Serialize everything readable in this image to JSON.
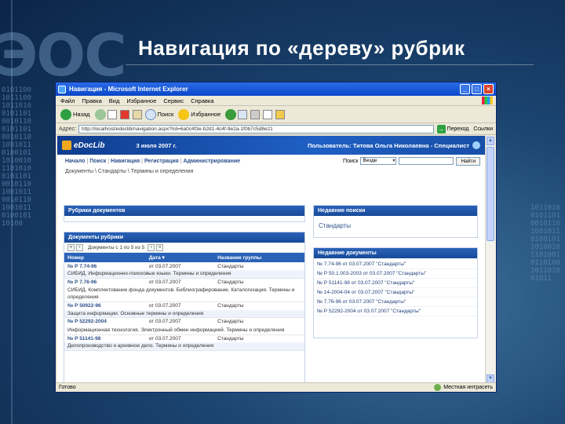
{
  "slide": {
    "title": "Навигация по «дереву» рубрик",
    "deco_logo": "ЭОС",
    "binary_left": "0101100101110010110100101101001011001011010010110100101101001011010010110101001011010010110100101100101101001011010010110100",
    "binary_right": "10110100101101001011010010110100101101001011010010110100101101001011"
  },
  "window": {
    "title": "Навигация - Microsoft Internet Explorer",
    "buttons": {
      "minimize": "_",
      "maximize": "□",
      "close": "×"
    },
    "menu": [
      "Файл",
      "Правка",
      "Вид",
      "Избранное",
      "Сервис",
      "Справка"
    ],
    "toolbar": {
      "back": "Назад",
      "search": "Поиск",
      "favorites": "Избранное"
    },
    "address": {
      "label": "Адрес:",
      "url": "http://localhost/edoclib/navigation.aspx?rid=6a0c4f3e-b2d1-4c4f-9e2a-1f0b7c5d8e21",
      "go": "Переход",
      "links": "Ссылки"
    },
    "status": {
      "text": "Готово",
      "zone": "Местная интрасеть"
    },
    "scroll": {
      "up": "▲",
      "down": "▼"
    }
  },
  "page": {
    "banner": {
      "logo": "eDocLib",
      "date": "3 июля 2007 г.",
      "user": "Пользователь: Титова Ольга Николаевна - Специалист"
    },
    "nav": [
      "Начало",
      "Поиск",
      "Навигация",
      "Регистрация",
      "Администрирование"
    ],
    "nav_sep": "|",
    "search": {
      "label": "Поиск",
      "scope": "Везде",
      "button": "Найти"
    },
    "breadcrumb": "Документы \\ Стандарты \\ Термины и определения",
    "panels": {
      "rubrics": "Рубрики документов",
      "recent_searches": "Недавние поиски",
      "documents": "Документы рубрики",
      "recent_documents": "Недавние документы"
    },
    "recent_search_items": [
      "Стандарты"
    ],
    "pager": {
      "first": "«",
      "prev": "‹",
      "text": "Документы с 1 по 5 из 5",
      "next": "›",
      "last": "»"
    },
    "table": {
      "headers": [
        "Номер",
        "Дата ▾",
        "Название группы"
      ],
      "rows": [
        {
          "number": "№ Р 7.74-96",
          "date": "от 03.07.2007",
          "group": "Стандарты",
          "title": "СИБИД. Информационно-поисковые языки. Термины и определения"
        },
        {
          "number": "№ Р 7.76-96",
          "date": "от 03.07.2007",
          "group": "Стандарты",
          "title": "СИБИД. Комплектование фонда документов. Библиографирование. Каталогизация. Термины и определения"
        },
        {
          "number": "№ Р 50922-96",
          "date": "от 03.07.2007",
          "group": "Стандарты",
          "title": "Защита информации. Основные термины и определения"
        },
        {
          "number": "№ Р 52292-2004",
          "date": "от 03.07.2007",
          "group": "Стандарты",
          "title": "Информационная технология. Электронный обмен информацией. Термины и определения"
        },
        {
          "number": "№ Р 51141-98",
          "date": "от 03.07.2007",
          "group": "Стандарты",
          "title": "Делопроизводство и архивное дело. Термины и определения"
        }
      ]
    },
    "recent_documents": [
      "№ 7.74-96 от 03.07.2007 \"Стандарты\"",
      "№ Р 50.1.003-2003 от 03.07.2007 \"Стандарты\"",
      "№ Р 51141-98 от 03.07.2007 \"Стандарты\"",
      "№ 14-2004-04 от 03.07.2007 \"Стандарты\"",
      "№ 7.76-96 от 03.07.2007 \"Стандарты\"",
      "№ Р 52292-2004 от 03.07.2007 \"Стандарты\""
    ]
  }
}
